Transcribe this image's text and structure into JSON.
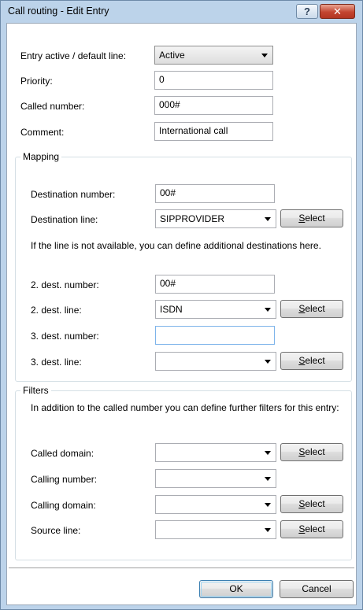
{
  "window": {
    "title": "Call routing - Edit Entry",
    "help_label": "?",
    "close_label": "✕"
  },
  "general": {
    "entry_active_label": "Entry active / default line:",
    "entry_active_value": "Active",
    "priority_label": "Priority:",
    "priority_value": "0",
    "called_number_label": "Called number:",
    "called_number_value": "000#",
    "comment_label": "Comment:",
    "comment_value": "International call"
  },
  "mapping": {
    "title": "Mapping",
    "dest_number_label": "Destination number:",
    "dest_number_value": "00#",
    "dest_line_label": "Destination line:",
    "dest_line_value": "SIPPROVIDER",
    "info_text": "If the line is not available, you can define additional destinations here.",
    "dest2_number_label": "2. dest. number:",
    "dest2_number_value": "00#",
    "dest2_line_label": "2. dest. line:",
    "dest2_line_value": "ISDN",
    "dest3_number_label": "3. dest. number:",
    "dest3_number_value": "",
    "dest3_line_label": "3. dest. line:",
    "dest3_line_value": ""
  },
  "filters": {
    "title": "Filters",
    "info_text": "In addition to the called number you can define further filters for this entry:",
    "called_domain_label": "Called domain:",
    "called_domain_value": "",
    "calling_number_label": "Calling number:",
    "calling_number_value": "",
    "calling_domain_label": "Calling domain:",
    "calling_domain_value": "",
    "source_line_label": "Source line:",
    "source_line_value": ""
  },
  "select_button": {
    "accel": "S",
    "rest": "elect"
  },
  "footer": {
    "ok_label": "OK",
    "cancel_label": "Cancel"
  }
}
